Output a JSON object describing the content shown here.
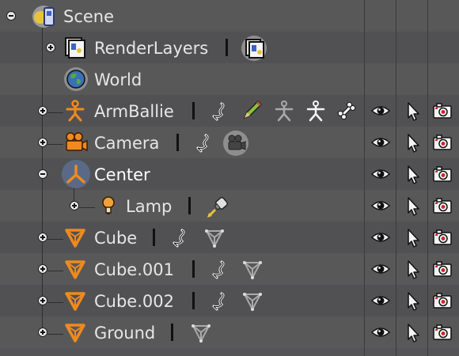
{
  "outliner": {
    "rows": [
      {
        "label": "Scene",
        "expanded": true
      },
      {
        "label": "RenderLayers",
        "expanded": false
      },
      {
        "label": "World"
      },
      {
        "label": "ArmBallie",
        "expanded": false
      },
      {
        "label": "Camera",
        "expanded": false
      },
      {
        "label": "Center",
        "expanded": true,
        "active": true
      },
      {
        "label": "Lamp",
        "expanded": false
      },
      {
        "label": "Cube",
        "expanded": false
      },
      {
        "label": "Cube.001",
        "expanded": false
      },
      {
        "label": "Cube.002",
        "expanded": false
      },
      {
        "label": "Ground",
        "expanded": false
      }
    ],
    "restrict_columns": [
      "visibility-eye-icon",
      "selectability-cursor-icon",
      "renderability-camera-icon"
    ]
  },
  "colors": {
    "background": "#555557",
    "object_orange": "#f08a1e",
    "selected_circle": "#5a6a86"
  }
}
